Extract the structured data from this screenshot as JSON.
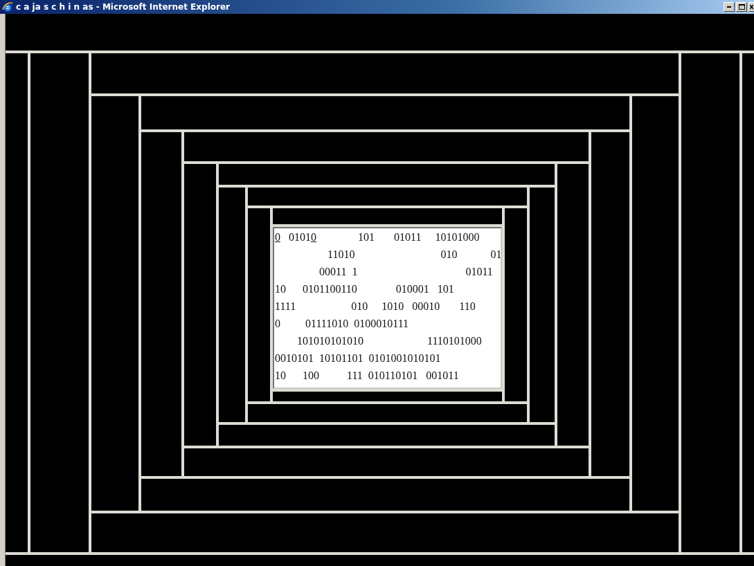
{
  "window": {
    "title": "c a ja s c h i n as - Microsoft Internet Explorer"
  },
  "frame_text": {
    "lines": [
      {
        "parts": [
          {
            "kind": "link",
            "text": "0"
          },
          {
            "kind": "text",
            "text": "   0101"
          },
          {
            "kind": "link",
            "text": "0"
          },
          {
            "kind": "text",
            "text": "               101       01011     10101000"
          }
        ]
      },
      {
        "parts": [
          {
            "kind": "text",
            "text": "                   11010                               010            01"
          }
        ]
      },
      {
        "parts": [
          {
            "kind": "text",
            "text": "                00011  1                                       01011"
          }
        ]
      },
      {
        "parts": [
          {
            "kind": "text",
            "text": "10      0101100110              010001   101"
          }
        ]
      },
      {
        "parts": [
          {
            "kind": "text",
            "text": "1111                    010     1010   00010       110"
          }
        ]
      },
      {
        "parts": [
          {
            "kind": "text",
            "text": "0         01111010  0100010111"
          }
        ]
      },
      {
        "parts": [
          {
            "kind": "text",
            "text": "        101010101010                       1110101000"
          }
        ]
      },
      {
        "parts": [
          {
            "kind": "text",
            "text": "0010101  10101101  0101001010101"
          }
        ]
      },
      {
        "parts": [
          {
            "kind": "text",
            "text": "10      100          111  010110101   001011"
          }
        ]
      }
    ]
  }
}
